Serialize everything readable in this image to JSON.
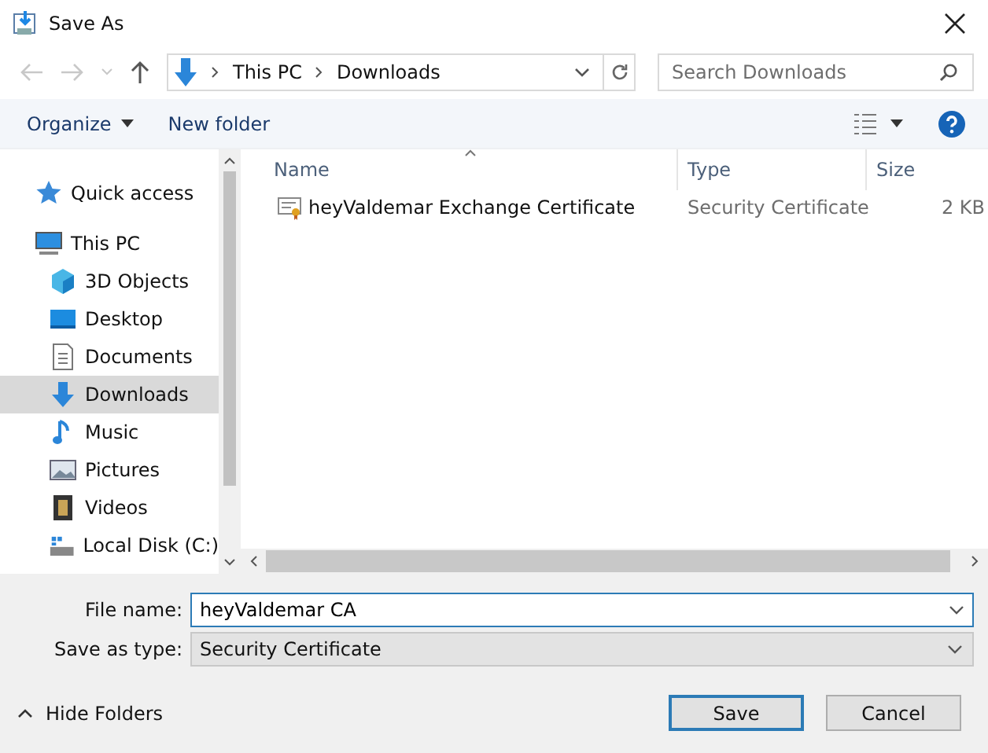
{
  "window": {
    "title": "Save As"
  },
  "address": {
    "crumbs": [
      "This PC",
      "Downloads"
    ]
  },
  "search": {
    "placeholder": "Search Downloads"
  },
  "toolbar": {
    "organize": "Organize",
    "new_folder": "New folder"
  },
  "sidebar": {
    "items": [
      {
        "label": "Quick access",
        "kind": "star",
        "selected": false
      },
      {
        "label": "This PC",
        "kind": "computer",
        "selected": false,
        "children": [
          {
            "label": "3D Objects",
            "kind": "cube",
            "selected": false
          },
          {
            "label": "Desktop",
            "kind": "desktop",
            "selected": false
          },
          {
            "label": "Documents",
            "kind": "document",
            "selected": false
          },
          {
            "label": "Downloads",
            "kind": "download",
            "selected": true
          },
          {
            "label": "Music",
            "kind": "music",
            "selected": false
          },
          {
            "label": "Pictures",
            "kind": "picture",
            "selected": false
          },
          {
            "label": "Videos",
            "kind": "video",
            "selected": false
          },
          {
            "label": "Local Disk (C:)",
            "kind": "drive",
            "selected": false
          }
        ]
      }
    ]
  },
  "table": {
    "columns": [
      "Name",
      "Type",
      "Size"
    ],
    "rows": [
      {
        "name": "heyValdemar Exchange Certificate",
        "type": "Security Certificate",
        "size": "2 KB"
      }
    ]
  },
  "form": {
    "file_name_label": "File name:",
    "file_name": "heyValdemar CA",
    "type_label": "Save as type:",
    "type": "Security Certificate"
  },
  "hide_folders": "Hide Folders",
  "buttons": [
    "Save",
    "Cancel"
  ]
}
